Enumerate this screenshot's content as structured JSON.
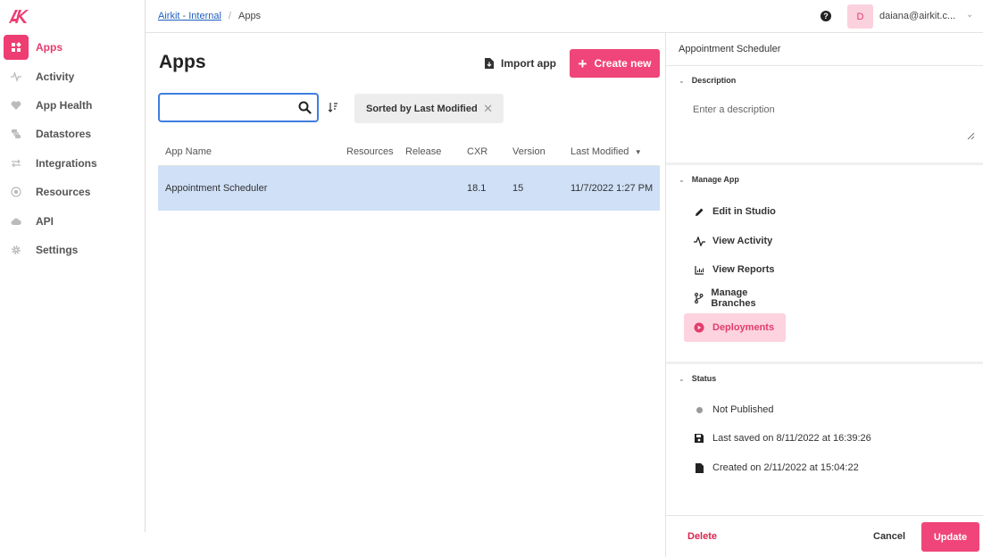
{
  "brand": {
    "logo_text": "AK",
    "accent": "#f0457a"
  },
  "sidebar": {
    "items": [
      {
        "label": "Apps",
        "icon": "apps-icon",
        "active": true
      },
      {
        "label": "Activity",
        "icon": "activity-icon"
      },
      {
        "label": "App Health",
        "icon": "heart-icon"
      },
      {
        "label": "Datastores",
        "icon": "database-icon"
      },
      {
        "label": "Integrations",
        "icon": "swap-icon"
      },
      {
        "label": "Resources",
        "icon": "resources-icon"
      },
      {
        "label": "API",
        "icon": "cloud-icon"
      },
      {
        "label": "Settings",
        "icon": "gear-icon"
      }
    ]
  },
  "topbar": {
    "breadcrumb": {
      "parent": "Airkit - Internal",
      "separator": "/",
      "current": "Apps"
    },
    "help_glyph": "?",
    "avatar_initial": "D",
    "user": "daiana@airkit.c...",
    "user_chevron": "⌄"
  },
  "main": {
    "title": "Apps",
    "import_label": "Import app",
    "create_label": "Create new",
    "create_glyph": "+",
    "search": {
      "placeholder": "",
      "value": ""
    },
    "sort_chip": "Sorted by Last Modified",
    "sort_clear_glyph": "✕",
    "columns": [
      "App Name",
      "Resources",
      "Release",
      "CXR",
      "Version",
      "Last Modified"
    ],
    "sort_caret": "▾",
    "rows": [
      {
        "name": "Appointment Scheduler",
        "resources": "",
        "release": "",
        "cxr": "18.1",
        "version": "15",
        "modified": "11/7/2022 1:27 PM"
      }
    ]
  },
  "panel": {
    "title": "Appointment Scheduler",
    "description": {
      "heading": "Description",
      "placeholder": "Enter a description"
    },
    "manage": {
      "heading": "Manage App",
      "actions": [
        {
          "label": "Edit in Studio",
          "icon": "pencil-icon"
        },
        {
          "label": "View Activity",
          "icon": "activity-icon"
        },
        {
          "label": "View Reports",
          "icon": "chart-icon"
        },
        {
          "label": "Manage Branches",
          "icon": "branch-icon"
        },
        {
          "label": "Deployments",
          "icon": "play-circle-icon",
          "active": true
        }
      ]
    },
    "status": {
      "heading": "Status",
      "items": [
        {
          "label": "Not Published",
          "icon": "dot-icon"
        },
        {
          "label": "Last saved on 8/11/2022 at 16:39:26",
          "icon": "save-icon"
        },
        {
          "label": "Created on 2/11/2022 at 15:04:22",
          "icon": "file-icon"
        }
      ]
    },
    "chevron": "⌄",
    "footer": {
      "delete_label": "Delete",
      "cancel_label": "Cancel",
      "update_label": "Update"
    }
  }
}
